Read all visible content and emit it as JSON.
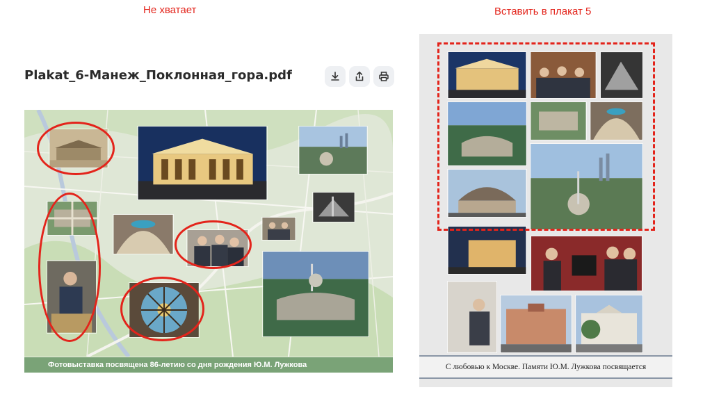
{
  "annotations": {
    "missing_label": "Не хватает",
    "insert_label": "Вставить в плакат 5"
  },
  "document": {
    "filename": "Plakat_6-Манеж_Поклонная_гора.pdf"
  },
  "toolbar": {
    "download_icon": "download-icon",
    "share_icon": "share-icon",
    "print_icon": "print-icon"
  },
  "poster_left": {
    "footer_caption": "Фотовыставка посвящена 86-летию со дня рождения Ю.М. Лужкова"
  },
  "poster_right": {
    "footer_caption": "С любовью к Москве. Памяти Ю.М. Лужкова посвящается"
  },
  "colors": {
    "annotation_red": "#e3241b",
    "poster_footer_green": "#7aa377",
    "toolbar_button_bg": "#eef0f3"
  }
}
